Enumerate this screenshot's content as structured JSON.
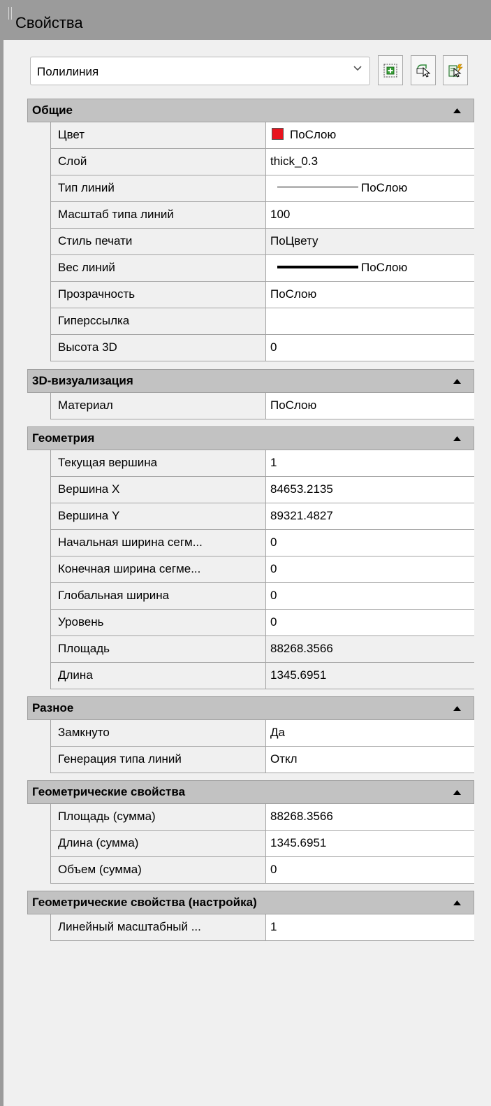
{
  "window": {
    "title": "Свойства"
  },
  "selector": {
    "value": "Полилиния"
  },
  "toolbar": {
    "icons": [
      "toggle-pickadd-icon",
      "select-objects-icon",
      "quick-select-icon"
    ]
  },
  "sections": {
    "general": {
      "title": "Общие",
      "rows": [
        {
          "name": "Цвет",
          "value": "ПоСлою",
          "swatch_color": "#e8141e"
        },
        {
          "name": "Слой",
          "value": "thick_0.3"
        },
        {
          "name": "Тип линий",
          "value": "ПоСлою"
        },
        {
          "name": "Масштаб типа линий",
          "value": "100"
        },
        {
          "name": "Стиль печати",
          "value": "ПоЦвету"
        },
        {
          "name": "Вес линий",
          "value": "ПоСлою"
        },
        {
          "name": "Прозрачность",
          "value": "ПоСлою"
        },
        {
          "name": "Гиперссылка",
          "value": ""
        },
        {
          "name": "Высота 3D",
          "value": "0"
        }
      ]
    },
    "viz3d": {
      "title": "3D-визуализация",
      "rows": [
        {
          "name": "Материал",
          "value": "ПоСлою"
        }
      ]
    },
    "geometry": {
      "title": "Геометрия",
      "rows": [
        {
          "name": "Текущая вершина",
          "value": "1"
        },
        {
          "name": "Вершина X",
          "value": "84653.2135"
        },
        {
          "name": "Вершина Y",
          "value": "89321.4827"
        },
        {
          "name": "Начальная ширина сегм...",
          "value": "0"
        },
        {
          "name": "Конечная ширина сегме...",
          "value": "0"
        },
        {
          "name": "Глобальная ширина",
          "value": "0"
        },
        {
          "name": "Уровень",
          "value": "0"
        },
        {
          "name": "Площадь",
          "value": "88268.3566"
        },
        {
          "name": "Длина",
          "value": "1345.6951"
        }
      ]
    },
    "misc": {
      "title": "Разное",
      "rows": [
        {
          "name": "Замкнуто",
          "value": "Да"
        },
        {
          "name": "Генерация типа линий",
          "value": "Откл"
        }
      ]
    },
    "geomprops": {
      "title": "Геометрические свойства",
      "rows": [
        {
          "name": "Площадь (сумма)",
          "value": "88268.3566"
        },
        {
          "name": "Длина (сумма)",
          "value": "1345.6951"
        },
        {
          "name": "Объем (сумма)",
          "value": "0"
        }
      ]
    },
    "geomsettings": {
      "title": "Геометрические свойства (настройка)",
      "rows": [
        {
          "name": "Линейный масштабный ...",
          "value": "1"
        }
      ]
    }
  }
}
